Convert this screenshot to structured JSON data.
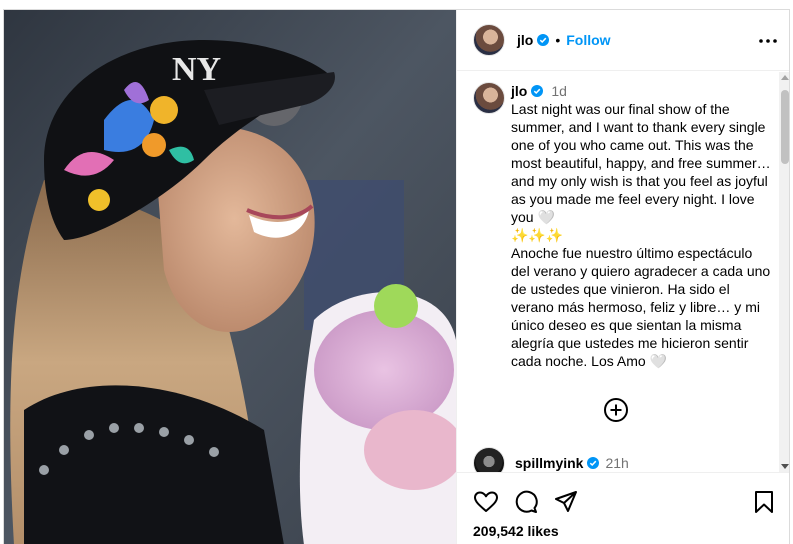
{
  "post": {
    "author": "jlo",
    "follow_label": "Follow",
    "dot": "•",
    "caption_time": "1d",
    "caption": "Last night was our final show of the summer, and I want to thank every single one of you who came out. This was the most beautiful, happy, and free summer…and my only wish is that you feel as joyful as you made me feel every night. I love you 🤍\n✨✨✨\nAnoche fue nuestro último espectáculo del verano y quiero agradecer a cada uno de ustedes que vinieron. Ha sido el verano más hermoso, feliz y libre… y mi único deseo es que sientan la misma alegría que ustedes me hicieron sentir cada noche. Los Amo 🤍",
    "likes": "209,542 likes"
  },
  "comments": [
    {
      "author": "spillmyink",
      "time": "21h"
    }
  ],
  "icons": {
    "verified": "verified-badge-icon",
    "more": "more-options-icon",
    "load_more": "plus-circle-icon",
    "like": "heart-icon",
    "comment": "comment-bubble-icon",
    "share": "paper-plane-icon",
    "save": "bookmark-icon"
  },
  "colors": {
    "accent": "#0095f6",
    "verified": "#0095f6",
    "muted": "#737373",
    "border": "#dbdbdb"
  }
}
